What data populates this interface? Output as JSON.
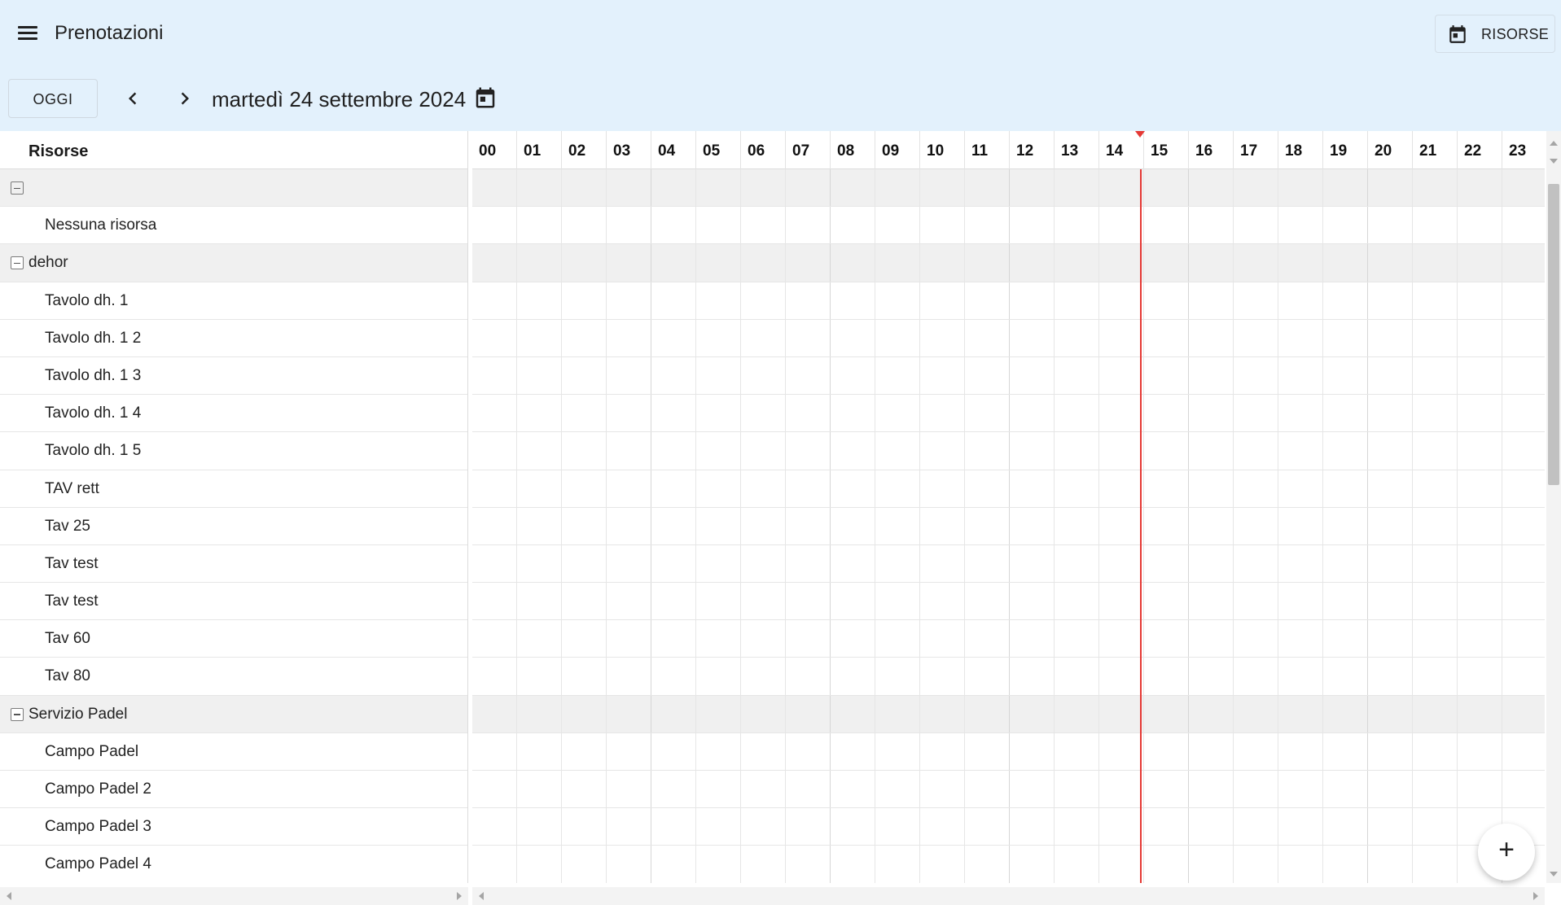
{
  "header": {
    "title": "Prenotazioni",
    "resources_button": "RISORSE",
    "menu_icon": "menu-icon",
    "calendar_icon": "calendar-icon"
  },
  "toolbar": {
    "today_button": "OGGI",
    "date_label": "martedì 24 settembre 2024"
  },
  "scheduler": {
    "resources_header": "Risorse",
    "hours": [
      "00",
      "01",
      "02",
      "03",
      "04",
      "05",
      "06",
      "07",
      "08",
      "09",
      "10",
      "11",
      "12",
      "13",
      "14",
      "15",
      "16",
      "17",
      "18",
      "19",
      "20",
      "21",
      "22",
      "23"
    ],
    "current_time_hour": 14.9,
    "rows": [
      {
        "type": "group",
        "label": ""
      },
      {
        "type": "resource",
        "label": "Nessuna risorsa"
      },
      {
        "type": "group",
        "label": "dehor"
      },
      {
        "type": "resource",
        "label": "Tavolo dh. 1"
      },
      {
        "type": "resource",
        "label": "Tavolo dh. 1 2"
      },
      {
        "type": "resource",
        "label": "Tavolo dh. 1 3"
      },
      {
        "type": "resource",
        "label": "Tavolo dh. 1 4"
      },
      {
        "type": "resource",
        "label": "Tavolo dh. 1 5"
      },
      {
        "type": "resource",
        "label": "TAV rett"
      },
      {
        "type": "resource",
        "label": "Tav 25"
      },
      {
        "type": "resource",
        "label": "Tav test"
      },
      {
        "type": "resource",
        "label": "Tav test"
      },
      {
        "type": "resource",
        "label": "Tav 60"
      },
      {
        "type": "resource",
        "label": "Tav 80"
      },
      {
        "type": "group",
        "label": "Servizio Padel"
      },
      {
        "type": "resource",
        "label": "Campo Padel"
      },
      {
        "type": "resource",
        "label": "Campo Padel 2"
      },
      {
        "type": "resource",
        "label": "Campo Padel 3"
      },
      {
        "type": "resource",
        "label": "Campo Padel 4"
      },
      {
        "type": "resource",
        "label": ""
      }
    ]
  },
  "fab": {
    "label": "+"
  },
  "colors": {
    "appbar": "#e3f1fc",
    "group_row": "#f0f0f0",
    "now_line": "#e53935"
  }
}
